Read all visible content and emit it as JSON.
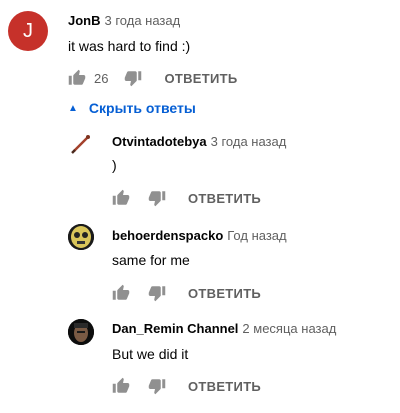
{
  "comment": {
    "avatar_letter": "J",
    "author": "JonB",
    "time": "3 года назад",
    "text": "it was hard to find :)",
    "likes": "26",
    "reply_label": "ОТВЕТИТЬ"
  },
  "replies_toggle": {
    "label": "Скрыть ответы",
    "icon": "caret-up-icon"
  },
  "replies": [
    {
      "author": "Otvintadotebya",
      "time": "3 года назад",
      "text": ")",
      "reply_label": "ОТВЕТИТЬ"
    },
    {
      "author": "behoerdenspacko",
      "time": "Год назад",
      "text": "same for me",
      "reply_label": "ОТВЕТИТЬ"
    },
    {
      "author": "Dan_Remin Channel",
      "time": "2 месяца назад",
      "text": "But we did it",
      "reply_label": "ОТВЕТИТЬ"
    }
  ],
  "colors": {
    "avatar_red": "#c6312a",
    "link_blue": "#065fd4",
    "muted": "#606060"
  }
}
